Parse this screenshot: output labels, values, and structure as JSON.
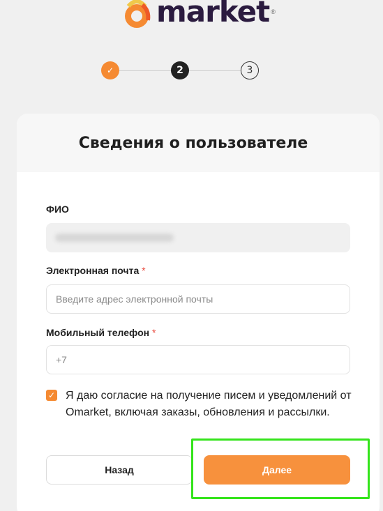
{
  "brand": {
    "name": "market",
    "accent": "#f58a32",
    "reg_mark": "®"
  },
  "steps": [
    {
      "label": "✓",
      "state": "done"
    },
    {
      "label": "2",
      "state": "active"
    },
    {
      "label": "3",
      "state": "todo"
    }
  ],
  "form": {
    "title": "Сведения о пользователе",
    "fio_label": "ФИО",
    "email_label": "Электронная почта",
    "email_placeholder": "Введите адрес электронной почты",
    "phone_label": "Мобильный телефон",
    "phone_value": "+7",
    "required_mark": "*",
    "consent_checked": true,
    "consent_text": "Я даю согласие на получение писем и уведомлений от Omarket, включая заказы, обновления и рассылки."
  },
  "actions": {
    "back_label": "Назад",
    "next_label": "Далее"
  }
}
